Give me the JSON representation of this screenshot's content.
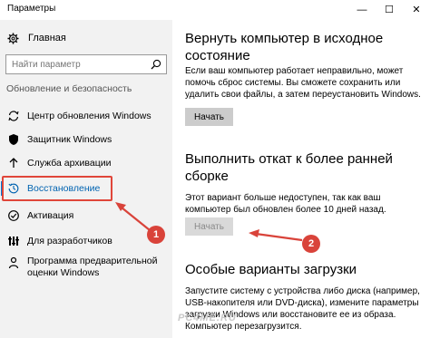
{
  "window": {
    "title": "Параметры",
    "minimize": "—",
    "maximize": "☐",
    "close": "✕"
  },
  "sidebar": {
    "home": "Главная",
    "search_placeholder": "Найти параметр",
    "section_title": "Обновление и безопасность",
    "items": [
      {
        "label": "Центр обновления Windows",
        "icon": "sync-icon"
      },
      {
        "label": "Защитник Windows",
        "icon": "shield-icon"
      },
      {
        "label": "Служба архивации",
        "icon": "backup-arrow-icon"
      },
      {
        "label": "Восстановление",
        "icon": "history-icon",
        "active": true
      },
      {
        "label": "Активация",
        "icon": "check-circle-icon"
      },
      {
        "label": "Для разработчиков",
        "icon": "developer-icon"
      },
      {
        "label": "Программа предварительной оценки Windows",
        "icon": "insider-icon"
      }
    ]
  },
  "main": {
    "reset": {
      "title": "Вернуть компьютер в исходное состояние",
      "text": "Если ваш компьютер работает неправильно, может помочь сброс системы. Вы сможете сохранить или удалить свои файлы, а затем переустановить Windows.",
      "button": "Начать"
    },
    "rollback": {
      "title": "Выполнить откат к более ранней сборке",
      "text": "Этот вариант больше недоступен, так как ваш компьютер был обновлен более 10 дней назад.",
      "button": "Начать"
    },
    "boot": {
      "title": "Особые варианты загрузки",
      "text": "Запустите систему с устройства либо диска (например, USB-накопителя или DVD-диска), измените параметры загрузки Windows или восстановите ее из образа. Компьютер перезагрузится."
    }
  },
  "watermark": "PC4ME.RU",
  "annotations": {
    "badge1": "1",
    "badge2": "2",
    "color": "#d9433a"
  },
  "colors": {
    "accent": "#0078d7",
    "active_text": "#0063b1",
    "sidebar_bg": "#f2f2f2",
    "button_bg": "#cccccc"
  }
}
